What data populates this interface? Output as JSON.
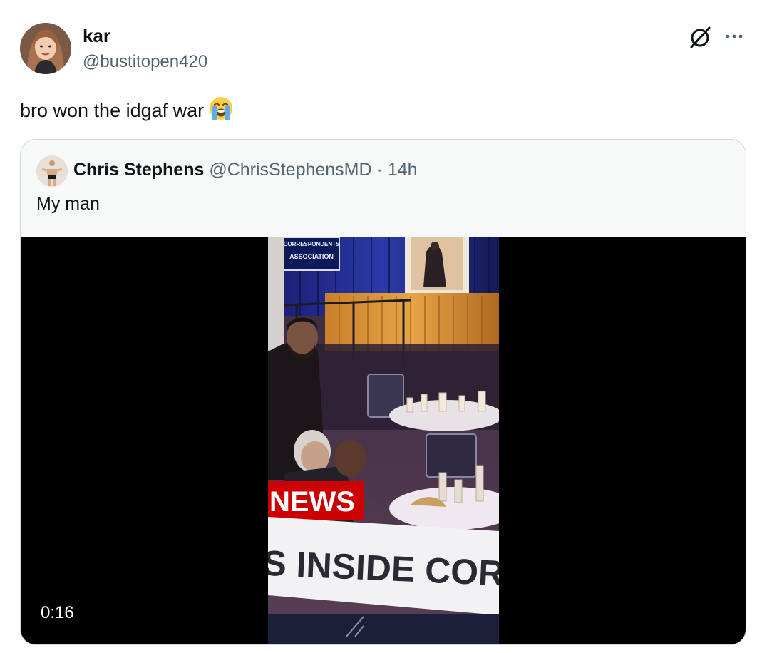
{
  "post": {
    "display_name": "kar",
    "handle": "@bustitopen420",
    "text": "bro won the idgaf war",
    "emoji_icon": "loudly-crying-face",
    "grok_icon": "grok-slash-circle",
    "more_icon": "ellipsis-horizontal"
  },
  "quoted": {
    "display_name": "Chris Stephens",
    "handle": "@ChrisStephensMD",
    "separator": "·",
    "time": "14h",
    "text": "My man",
    "video": {
      "duration": "0:16",
      "banner_tag": "NEWS",
      "banner_text": "S INSIDE CORRESPON",
      "backdrop_sign_line1": "CORRESPONDENTS",
      "backdrop_sign_line2": "ASSOCIATION"
    }
  },
  "colors": {
    "text_primary": "#0f1419",
    "text_secondary": "#536471",
    "card_border": "#cfd9de",
    "card_bg": "#f7f9f9",
    "news_red": "#cc0000"
  }
}
